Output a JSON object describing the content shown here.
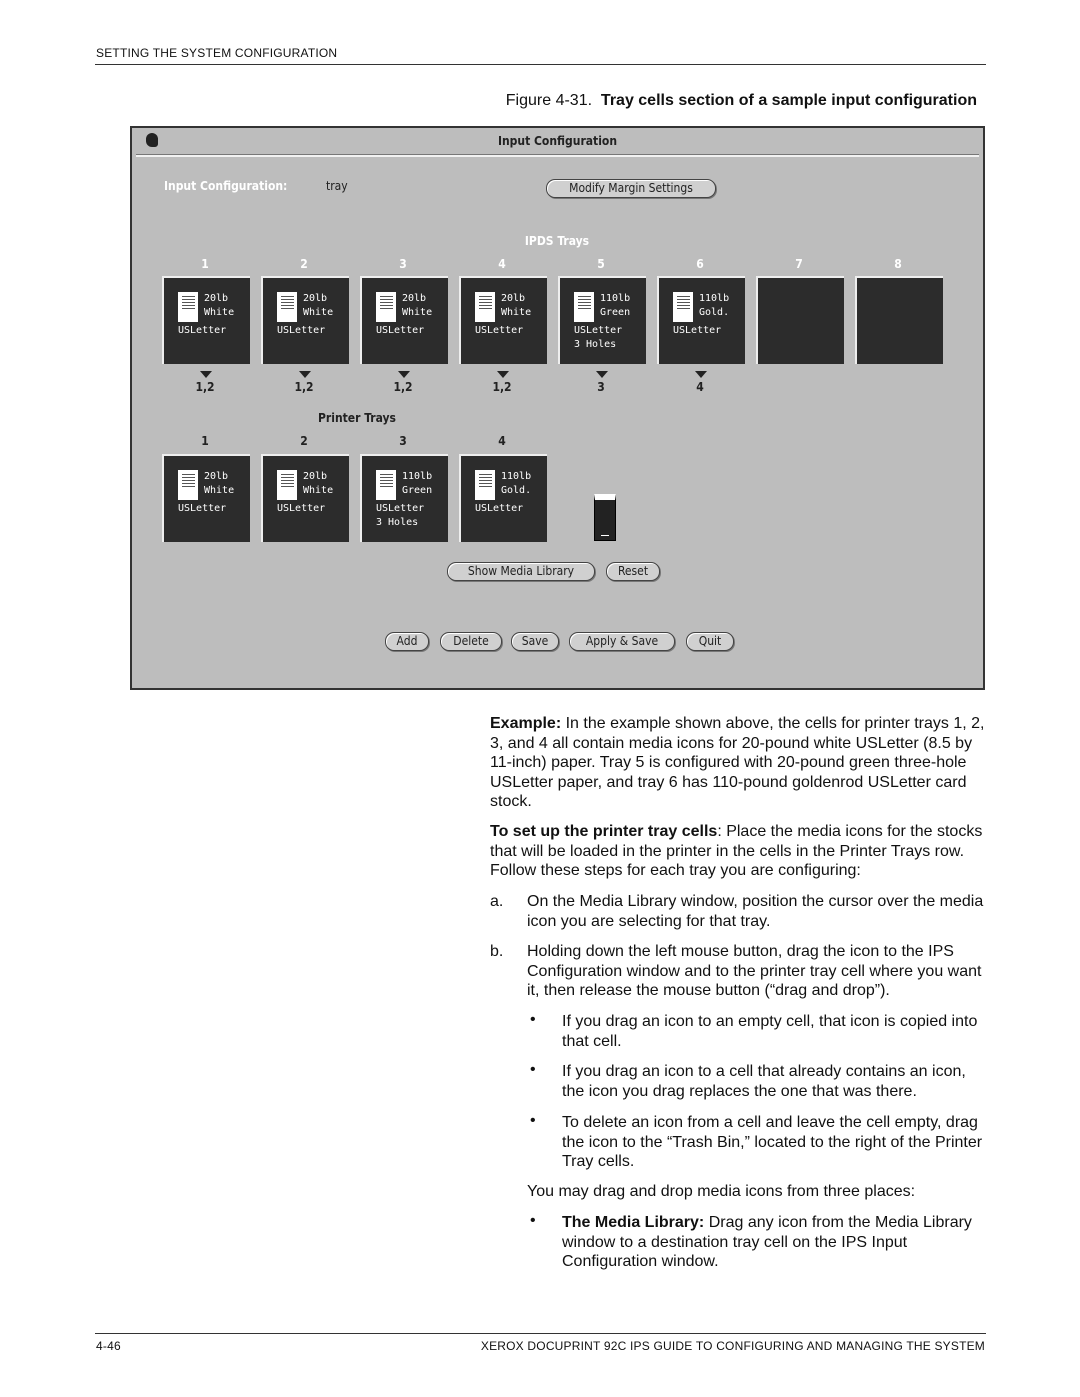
{
  "header": {
    "section": "SETTING THE SYSTEM CONFIGURATION"
  },
  "figure": {
    "number": "Figure 4-31.",
    "title": "Tray cells section of a sample input configuration"
  },
  "window": {
    "title": "Input Configuration",
    "config_label": "Input Configuration:",
    "config_value": "tray",
    "modify_margin_button": "Modify Margin Settings",
    "ipds_heading": "IPDS Trays",
    "ipds_trays": [
      {
        "num": "1",
        "weight": "20lb",
        "color": "White",
        "size": "USLetter",
        "extra": "",
        "mapping": "1,2"
      },
      {
        "num": "2",
        "weight": "20lb",
        "color": "White",
        "size": "USLetter",
        "extra": "",
        "mapping": "1,2"
      },
      {
        "num": "3",
        "weight": "20lb",
        "color": "White",
        "size": "USLetter",
        "extra": "",
        "mapping": "1,2"
      },
      {
        "num": "4",
        "weight": "20lb",
        "color": "White",
        "size": "USLetter",
        "extra": "",
        "mapping": "1,2"
      },
      {
        "num": "5",
        "weight": "110lb",
        "color": "Green",
        "size": "USLetter",
        "extra": "3 Holes",
        "mapping": "3"
      },
      {
        "num": "6",
        "weight": "110lb",
        "color": "Gold.",
        "size": "USLetter",
        "extra": "",
        "mapping": "4"
      },
      {
        "num": "7"
      },
      {
        "num": "8"
      }
    ],
    "printer_heading": "Printer Trays",
    "printer_trays": [
      {
        "num": "1",
        "weight": "20lb",
        "color": "White",
        "size": "USLetter",
        "extra": ""
      },
      {
        "num": "2",
        "weight": "20lb",
        "color": "White",
        "size": "USLetter",
        "extra": ""
      },
      {
        "num": "3",
        "weight": "110lb",
        "color": "Green",
        "size": "USLetter",
        "extra": "3 Holes"
      },
      {
        "num": "4",
        "weight": "110lb",
        "color": "Gold.",
        "size": "USLetter",
        "extra": ""
      }
    ],
    "show_media_library_button": "Show Media Library",
    "reset_button": "Reset",
    "buttons": {
      "add": "Add",
      "delete": "Delete",
      "save": "Save",
      "apply_save": "Apply & Save",
      "quit": "Quit"
    }
  },
  "text": {
    "example_lead": "Example:",
    "example_body": " In the example shown above, the cells for printer trays 1, 2, 3, and 4 all contain media icons for 20-pound white USLetter (8.5 by 11-inch) paper. Tray 5 is configured with 20-pound green three-hole USLetter paper, and tray 6 has 110-pound goldenrod USLetter card stock.",
    "setup_lead": "To set up the printer tray cells",
    "setup_body": ": Place the media icons for the stocks that will be loaded in the printer in the cells in the Printer Trays row. Follow these steps for each tray you are configuring:",
    "step_a_letter": "a.",
    "step_a": "On the Media Library window, position the cursor over the media icon you are selecting for that tray.",
    "step_b_letter": "b.",
    "step_b": "Holding down the left mouse button, drag the icon to the IPS Configuration window and to the printer tray cell where you want it, then release the mouse button (“drag and drop”).",
    "bullets": [
      "If you drag an icon to an empty cell, that icon is copied into that cell.",
      "If you drag an icon to a cell that already contains an icon, the icon you drag replaces the one that was there.",
      "To delete an icon from a cell and leave the cell empty, drag the icon to the “Trash Bin,” located to the right of the Printer Tray cells."
    ],
    "places_intro": "You may drag and drop media icons from three places:",
    "place1_lead": "The Media Library:",
    "place1_body": " Drag any icon from the Media Library window to a destination tray cell on the IPS Input Configuration window.",
    "bullet_char": "•"
  },
  "footer": {
    "page": "4-46",
    "title": "XEROX DOCUPRINT 92C IPS GUIDE TO CONFIGURING AND MANAGING THE SYSTEM"
  }
}
